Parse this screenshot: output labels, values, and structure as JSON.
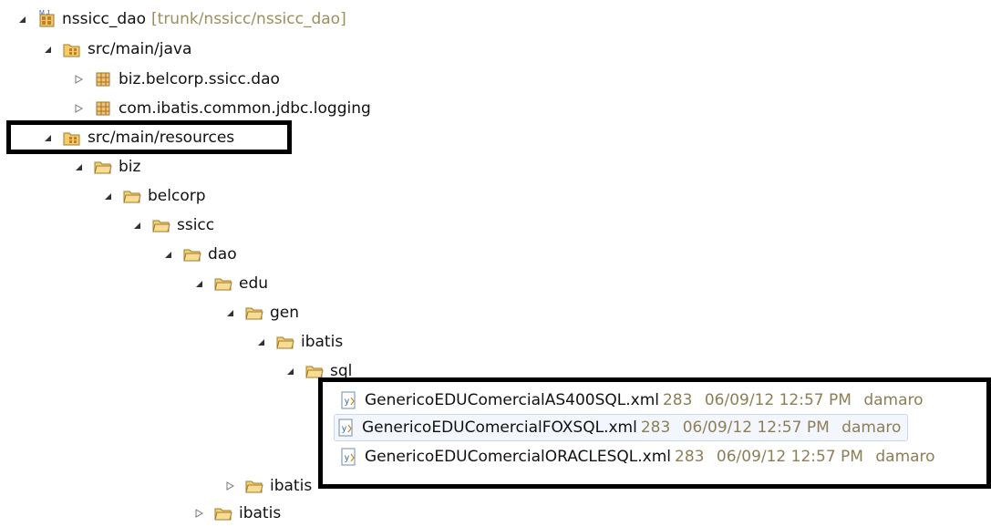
{
  "tree": {
    "project": {
      "name": "nssicc_dao",
      "decoration": "[trunk/nssicc/nssicc_dao]"
    },
    "src_main_java": "src/main/java",
    "pkg1": "biz.belcorp.ssicc.dao",
    "pkg2": "com.ibatis.common.jdbc.logging",
    "src_main_resources": "src/main/resources",
    "folders": {
      "biz": "biz",
      "belcorp": "belcorp",
      "ssicc": "ssicc",
      "dao": "dao",
      "edu": "edu",
      "gen": "gen",
      "ibatis": "ibatis",
      "sql": "sql",
      "ibatis2": "ibatis",
      "ibatis3": "ibatis"
    },
    "files": [
      {
        "name": "GenericoEDUComercialAS400SQL.xml",
        "rev": "283",
        "date": "06/09/12 12:57 PM",
        "author": "damaro"
      },
      {
        "name": "GenericoEDUComercialFOXSQL.xml",
        "rev": "283",
        "date": "06/09/12 12:57 PM",
        "author": "damaro"
      },
      {
        "name": "GenericoEDUComercialORACLESQL.xml",
        "rev": "283",
        "date": "06/09/12 12:57 PM",
        "author": "damaro"
      }
    ]
  },
  "icons": {
    "expanded": "expanded-arrow-icon",
    "collapsed": "collapsed-arrow-icon",
    "project": "project-icon",
    "source_folder": "source-folder-icon",
    "package": "package-icon",
    "folder": "folder-icon",
    "xml_file": "xml-file-icon"
  },
  "colors": {
    "decoration": "#9c8e5d",
    "highlight": "#000000",
    "selection": "#f3f7fd"
  }
}
